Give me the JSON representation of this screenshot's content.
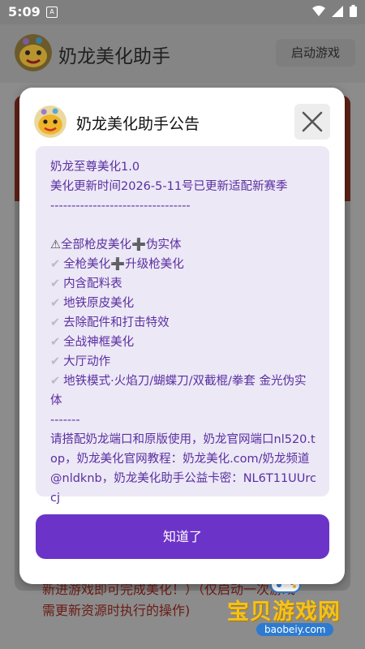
{
  "status_bar": {
    "time": "5:09",
    "app_icon": "A"
  },
  "app_bar": {
    "title": "奶龙美化助手",
    "launch_button": "启动游戏"
  },
  "background": {
    "note_line1": "新进游戏即可完成美化！）（仅启动一次游戏",
    "note_line2": "需更新资源时执行的操作)"
  },
  "watermark": {
    "main": "宝贝游戏网",
    "url": "baobeiy.com"
  },
  "dialog": {
    "title": "奶龙美化助手公告",
    "lines": {
      "l1": "奶龙至尊美化1.0",
      "l2": "美化更新时间2026-5-11号已更新适配新赛季",
      "sep1": "---------------------------------",
      "warn_icon": "⚠",
      "l3a": "全部枪皮美化",
      "plus": "➕",
      "l3b": "伪实体",
      "check": "✔",
      "l4a": "全枪美化",
      "l4b": "升级枪美化",
      "l5": "内含配料表",
      "l6": "地铁原皮美化",
      "l7": "去除配件和打击特效",
      "l8": "全战神框美化",
      "l9": "大厅动作",
      "l10": "地铁模式·火焰刀/蝴蝶刀/双截棍/拳套 金光伪实体",
      "sep2": "-------",
      "l11": "请搭配奶龙端口和原版使用，奶龙官网端口nl520.top，奶龙美化官网教程：奶龙美化.com/奶龙频道@nldknb，奶龙美化助手公益卡密：NL6T11UUrccj"
    },
    "ok_button": "知道了"
  },
  "colors": {
    "accent": "#6c33c8",
    "content_bg": "#ece8f6",
    "content_text": "#5a2fa0"
  },
  "icons": [
    "wifi-icon",
    "signal-icon",
    "battery-icon",
    "close-icon",
    "warning-icon",
    "check-icon",
    "plus-icon",
    "dragon-avatar-icon"
  ]
}
